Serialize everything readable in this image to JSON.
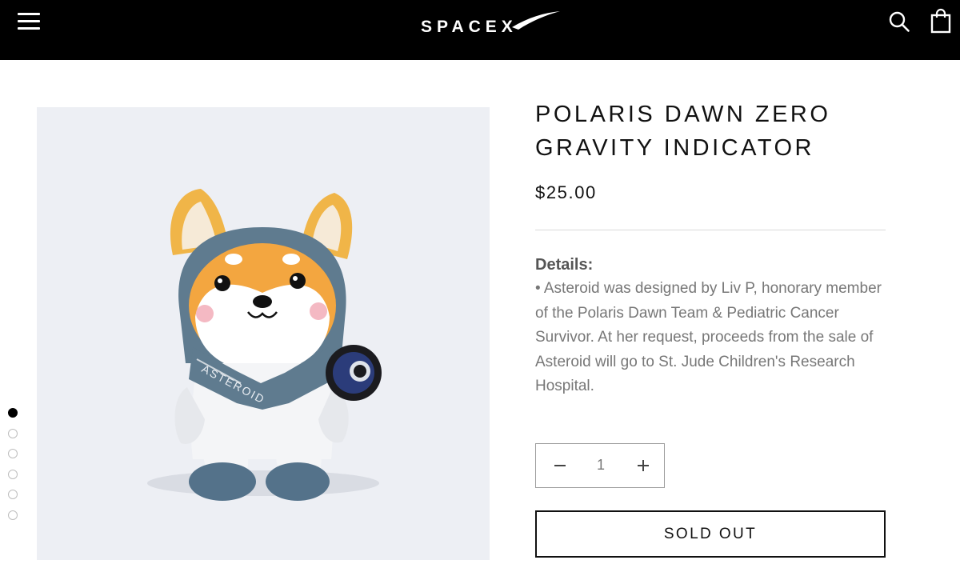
{
  "header": {
    "logo_text": "SPACEX",
    "menu_icon": "hamburger-menu-icon",
    "search_icon": "search-icon",
    "cart_icon": "shopping-bag-icon",
    "background": "#000000"
  },
  "gallery": {
    "image_subject": "plush shiba inu dog toy in blue astronaut suit with mission patch",
    "suit_text": "ASTEROID",
    "slide_count": 6,
    "active_slide": 1
  },
  "product": {
    "title": "POLARIS DAWN ZERO GRAVITY INDICATOR",
    "price": "$25.00",
    "details_heading": "Details:",
    "details_body": "• Asteroid was designed by Liv P, honorary member of the Polaris Dawn Team & Pediatric Cancer Survivor. At her request, proceeds from the sale of Asteroid will go to St. Jude Children's Research Hospital."
  },
  "quantity": {
    "value": "1",
    "minus_icon": "minus-icon",
    "plus_icon": "plus-icon"
  },
  "cta": {
    "label": "SOLD OUT"
  }
}
